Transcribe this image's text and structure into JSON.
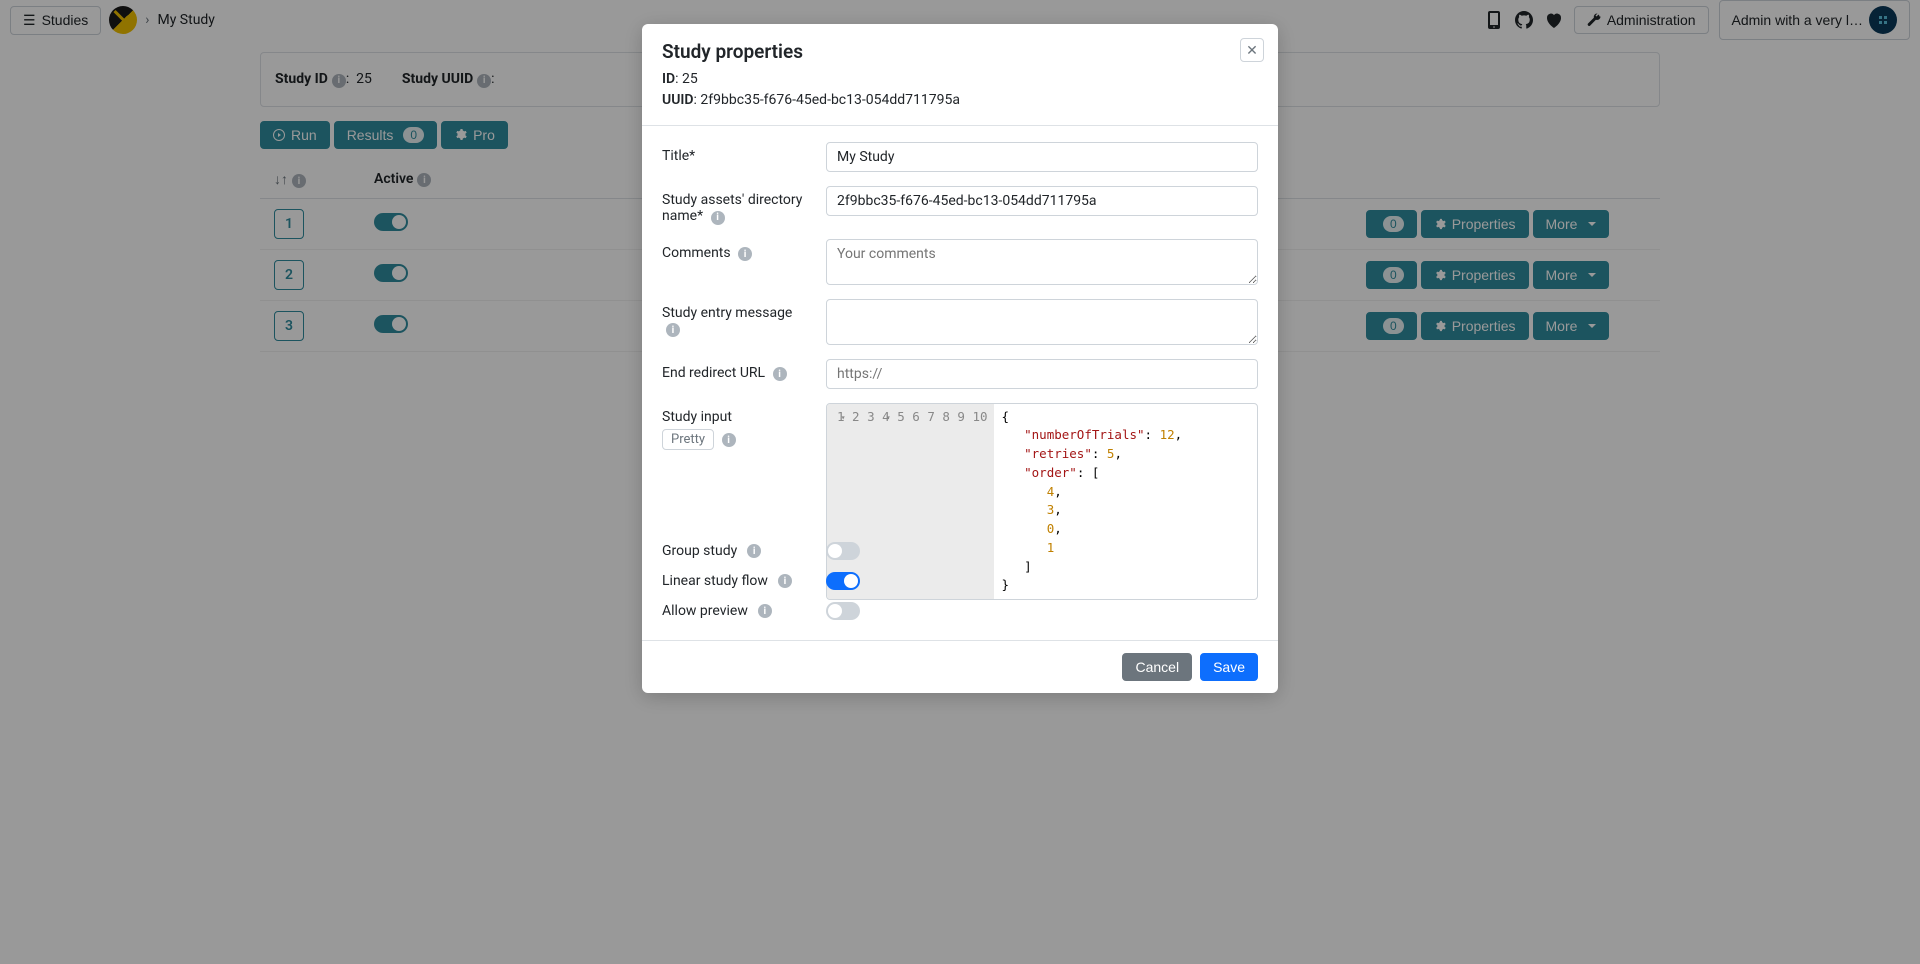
{
  "topbar": {
    "studies_btn": "Studies",
    "breadcrumb_title": "My Study",
    "admin_btn": "Administration",
    "user_btn": "Admin with a very l…"
  },
  "study_meta": {
    "id_label": "Study ID",
    "id_value": "25",
    "uuid_label": "Study UUID"
  },
  "actions": {
    "run": "Run",
    "results": "Results",
    "results_count": "0",
    "properties": "Pro"
  },
  "table": {
    "header_active": "Active",
    "rows": [
      {
        "order": "1",
        "active": true,
        "results": "0",
        "props": "Properties",
        "more": "More"
      },
      {
        "order": "2",
        "active": true,
        "results": "0",
        "props": "Properties",
        "more": "More"
      },
      {
        "order": "3",
        "active": true,
        "results": "0",
        "props": "Properties",
        "more": "More"
      }
    ]
  },
  "modal": {
    "title": "Study properties",
    "id_label": "ID",
    "id_value": "25",
    "uuid_label": "UUID",
    "uuid_value": "2f9bbc35-f676-45ed-bc13-054dd711795a",
    "form": {
      "title_label": "Title",
      "title_value": "My Study",
      "dir_label": "Study assets' directory name",
      "dir_value": "2f9bbc35-f676-45ed-bc13-054dd711795a",
      "comments_label": "Comments",
      "comments_placeholder": "Your comments",
      "entry_label": "Study entry message",
      "redirect_label": "End redirect URL",
      "redirect_placeholder": "https://",
      "input_label": "Study input",
      "pretty_btn": "Pretty",
      "group_label": "Group study",
      "group_value": false,
      "linear_label": "Linear study flow",
      "linear_value": true,
      "preview_label": "Allow preview",
      "preview_value": false
    },
    "code": {
      "lines": [
        "1",
        "2",
        "3",
        "4",
        "5",
        "6",
        "7",
        "8",
        "9",
        "10"
      ],
      "json": {
        "numberOfTrials": 12,
        "retries": 5,
        "order": [
          4,
          3,
          0,
          1
        ]
      }
    },
    "footer": {
      "cancel": "Cancel",
      "save": "Save"
    }
  }
}
